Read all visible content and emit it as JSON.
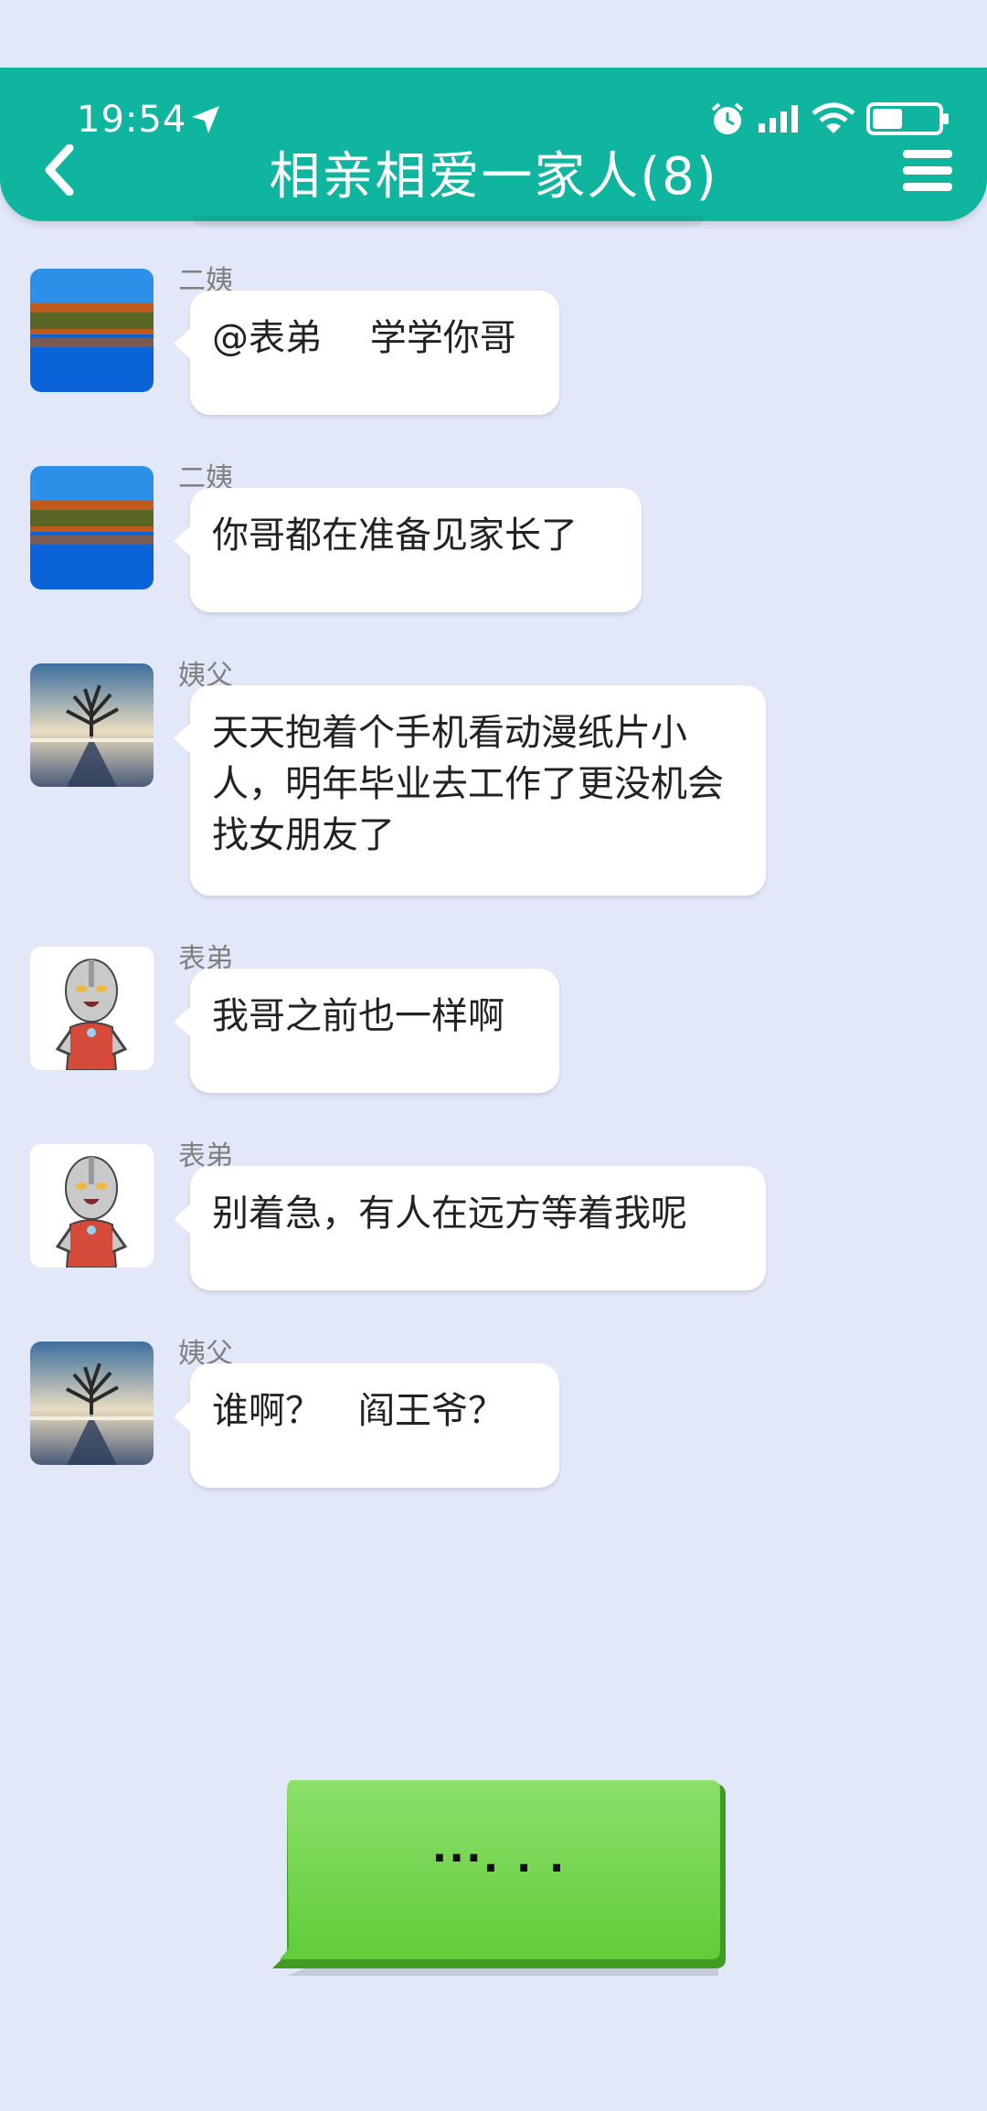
{
  "status_bar": {
    "time": "19:54"
  },
  "header": {
    "title": "相亲相爱一家人(8)"
  },
  "messages": [
    {
      "sender": "二姨",
      "text": "@表弟　 学学你哥",
      "avatar": "lake-autumn-avatar"
    },
    {
      "sender": "二姨",
      "text": "你哥都在准备见家长了",
      "avatar": "lake-autumn-avatar"
    },
    {
      "sender": "姨父",
      "text": "天天抱着个手机看动漫纸片小人，明年毕业去工作了更没机会找女朋友了",
      "avatar": "tree-sunset-avatar"
    },
    {
      "sender": "表弟",
      "text": "我哥之前也一样啊",
      "avatar": "ultraman-avatar"
    },
    {
      "sender": "表弟",
      "text": "别着急，有人在远方等着我呢",
      "avatar": "ultraman-avatar"
    },
    {
      "sender": "姨父",
      "text": "谁啊？　阎王爷？",
      "avatar": "tree-sunset-avatar"
    }
  ],
  "reply_bubble": {
    "text": "···. . ."
  },
  "colors": {
    "header": "#10b59f",
    "background": "#e2e8f8",
    "reply_bubble": "#6fd24a"
  }
}
